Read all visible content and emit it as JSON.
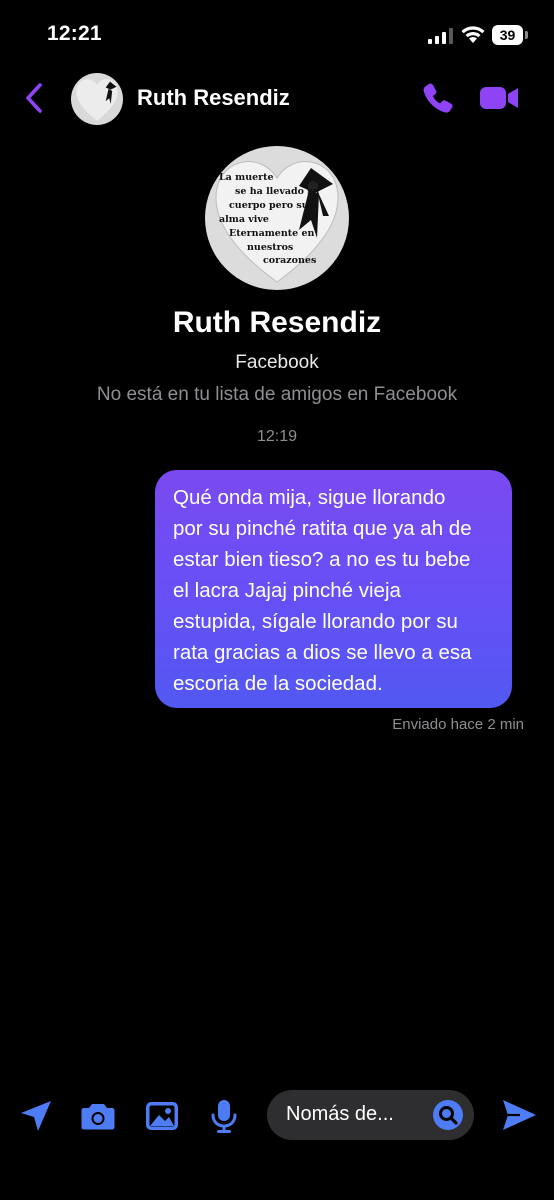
{
  "status_bar": {
    "time": "12:21",
    "battery": "39"
  },
  "header": {
    "contact_name": "Ruth Resendiz",
    "back_icon": "chevron-left-icon",
    "call_icon": "phone-icon",
    "video_icon": "video-camera-icon"
  },
  "avatar_text": {
    "lines": [
      "La muerte",
      "se ha llevado su",
      "cuerpo pero su",
      "alma vive",
      "Eternamente en",
      "nuestros",
      "corazones"
    ]
  },
  "profile": {
    "name": "Ruth Resendiz",
    "source": "Facebook",
    "friend_note": "No está en tu lista de amigos en Facebook"
  },
  "conversation": {
    "timestamp": "12:19",
    "messages": [
      {
        "direction": "sent",
        "text": "Qué onda mija, sigue llorando\npor su pinché ratita que ya ah de\nestar bien tieso? a no es tu bebe\nel lacra Jajaj pinché vieja\nestupida, sígale llorando por su\nrata gracias a dios se llevo a esa\nescoria de la sociedad.",
        "status": "Enviado hace 2 min"
      }
    ]
  },
  "composer": {
    "placeholder": "Nomás de...",
    "icons": [
      "location-arrow-icon",
      "camera-icon",
      "image-icon",
      "microphone-icon",
      "search-icon",
      "send-icon"
    ]
  },
  "colors": {
    "accent": "#8e44f5",
    "bubble_top": "#7a4af0",
    "bubble_bottom": "#5258f2",
    "composer_blue": "#4d7cf5"
  }
}
